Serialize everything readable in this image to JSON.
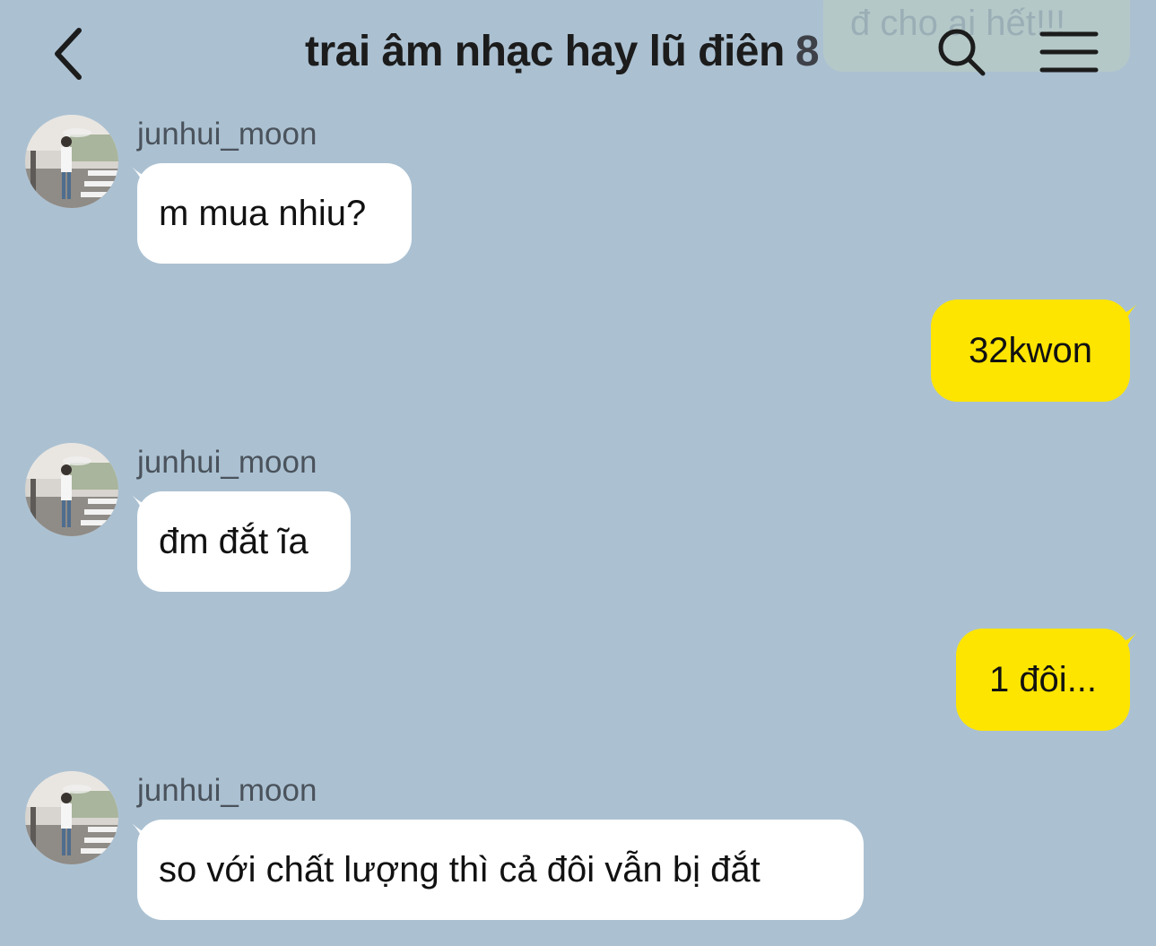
{
  "header": {
    "back_icon": "chevron-left-icon",
    "title": "trai âm nhạc hay lũ điên",
    "member_count": "8",
    "search_icon": "search-icon",
    "menu_icon": "hamburger-menu-icon",
    "ghost_text": "đ cho ai hết!!!"
  },
  "colors": {
    "background": "#abc1d2",
    "incoming_bubble": "#ffffff",
    "outgoing_bubble": "#fee500",
    "sender_name": "#4a525b"
  },
  "messages": [
    {
      "direction": "incoming",
      "sender": "junhui_moon",
      "text": "m mua nhiu?"
    },
    {
      "direction": "outgoing",
      "text": "32kwon"
    },
    {
      "direction": "incoming",
      "sender": "junhui_moon",
      "text": "đm đắt ĩa"
    },
    {
      "direction": "outgoing",
      "text": "1 đôi..."
    },
    {
      "direction": "incoming",
      "sender": "junhui_moon",
      "text": "so với chất lượng thì cả đôi vẫn bị đắt"
    }
  ]
}
